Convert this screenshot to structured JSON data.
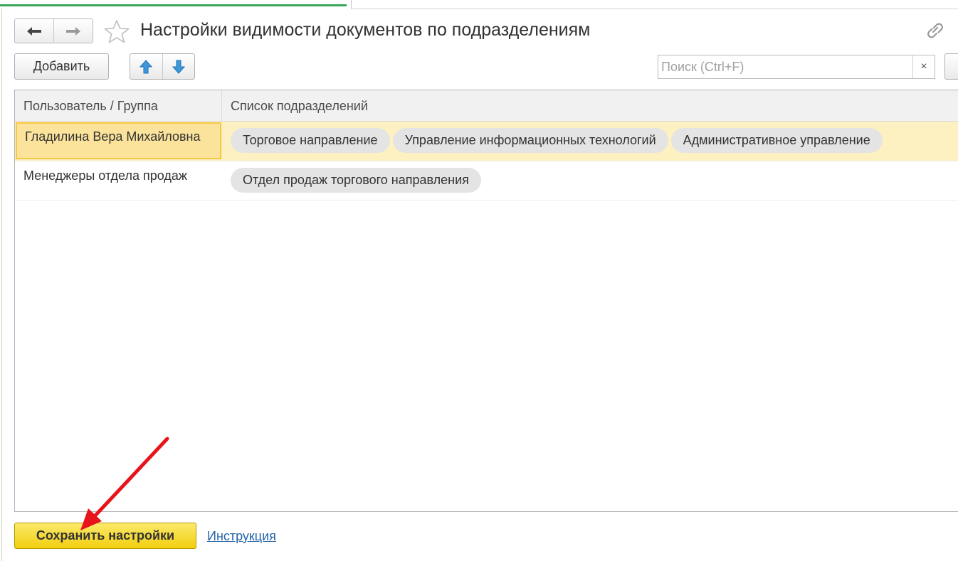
{
  "window": {
    "title": "Настройки видимости документов по подразделениям"
  },
  "icons": {
    "back": "arrow-left-icon",
    "forward": "arrow-right-icon",
    "favorite": "star-icon",
    "link": "link-icon",
    "move_up": "arrow-up-icon",
    "move_down": "arrow-down-icon",
    "clear": "close-icon"
  },
  "toolbar": {
    "add_label": "Добавить"
  },
  "search": {
    "placeholder": "Поиск (Ctrl+F)",
    "value": "",
    "clear_label": "×"
  },
  "table": {
    "columns": [
      "Пользователь / Группа",
      "Список подразделений"
    ],
    "rows": [
      {
        "user": "Гладилина Вера Михайловна",
        "selected": true,
        "departments": [
          "Торговое направление",
          "Управление информационных технологий",
          "Административное управление"
        ]
      },
      {
        "user": "Менеджеры отдела продаж",
        "selected": false,
        "departments": [
          "Отдел продаж торгового направления"
        ]
      }
    ]
  },
  "footer": {
    "save_label": "Сохранить настройки",
    "help_link": "Инструкция"
  },
  "colors": {
    "accent_green": "#39a657",
    "selected_row": "#fdf1c1",
    "selected_cell_border": "#f7c646",
    "save_button": "#f5d92a",
    "link": "#2463a8",
    "annotation_arrow": "#e8141c"
  }
}
